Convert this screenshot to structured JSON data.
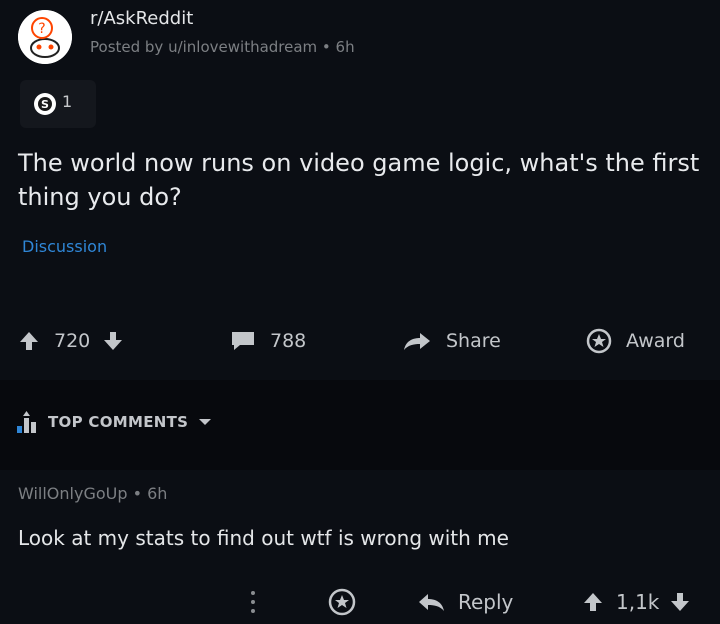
{
  "post": {
    "subreddit": "r/AskReddit",
    "posted_by": "Posted by u/inlovewithadream • 6h",
    "award_count": "1",
    "title": "The world now runs on video game logic, what's the first thing you do?",
    "flair": "Discussion"
  },
  "actions": {
    "votes": "720",
    "comments": "788",
    "share_label": "Share",
    "award_label": "Award"
  },
  "comments_header": {
    "sort_label": "TOP COMMENTS"
  },
  "comment": {
    "author_line": "WillOnlyGoUp • 6h",
    "body": "Look at my stats to find out wtf is wrong with me",
    "reply_label": "Reply",
    "votes": "1,1k"
  },
  "colors": {
    "background": "#0b0e14",
    "flair_blue": "#2f86d6",
    "muted": "#7c7f83"
  },
  "icons": [
    "subreddit-avatar-icon",
    "coin-award-icon",
    "upvote-icon",
    "downvote-icon",
    "comment-icon",
    "share-arrow-icon",
    "award-icon",
    "sort-bars-icon",
    "caret-down-icon",
    "more-icon",
    "reply-icon"
  ]
}
